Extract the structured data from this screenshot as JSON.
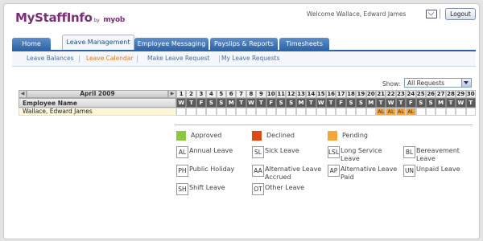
{
  "app": {
    "logo_main": "MyStaffInfo",
    "logo_by": "by",
    "logo_brand": "myob",
    "welcome": "Welcome Wallace, Edward James",
    "logout": "Logout"
  },
  "tabs": [
    {
      "label": "Home",
      "active": false
    },
    {
      "label": "Leave Management",
      "active": true
    },
    {
      "label": "Employee Messaging",
      "active": false
    },
    {
      "label": "Payslips & Reports",
      "active": false
    },
    {
      "label": "Timesheets",
      "active": false
    }
  ],
  "subnav": [
    {
      "label": "Leave Balances",
      "active": false
    },
    {
      "label": "Leave Calendar",
      "active": true
    },
    {
      "label": "Make Leave Request",
      "active": false
    },
    {
      "label": "My Leave Requests",
      "active": false
    }
  ],
  "filter": {
    "show_label": "Show:",
    "selected": "All Requests"
  },
  "calendar": {
    "month": "April 2009",
    "prev": "◀",
    "next": "▶",
    "employee_header": "Employee Name",
    "days": [
      "1",
      "2",
      "3",
      "4",
      "5",
      "6",
      "7",
      "8",
      "9",
      "10",
      "11",
      "12",
      "13",
      "14",
      "15",
      "16",
      "17",
      "18",
      "19",
      "20",
      "21",
      "22",
      "23",
      "24",
      "25",
      "26",
      "27",
      "28",
      "29",
      "30"
    ],
    "weekdays": [
      "W",
      "T",
      "F",
      "S",
      "S",
      "M",
      "T",
      "W",
      "T",
      "F",
      "S",
      "S",
      "M",
      "T",
      "W",
      "T",
      "F",
      "S",
      "S",
      "M",
      "T",
      "W",
      "T",
      "F",
      "S",
      "S",
      "M",
      "T",
      "W",
      "T"
    ],
    "employees": [
      {
        "name": "Wallace, Edward James",
        "cells": [
          "",
          "",
          "",
          "",
          "",
          "",
          "",
          "",
          "",
          "",
          "",
          "",
          "",
          "",
          "",
          "",
          "",
          "",
          "",
          "",
          "AL",
          "AL",
          "AL",
          "AL",
          "",
          "",
          "",
          "",
          "",
          ""
        ]
      }
    ]
  },
  "legend": {
    "statuses": [
      {
        "label": "Approved",
        "color": "#8dc63f"
      },
      {
        "label": "Declined",
        "color": "#e04a12"
      },
      {
        "label": "Pending",
        "color": "#f6a53a"
      }
    ],
    "codes": [
      {
        "code": "AL",
        "label": "Annual Leave"
      },
      {
        "code": "SL",
        "label": "Sick Leave"
      },
      {
        "code": "LSL",
        "label": "Long Service Leave"
      },
      {
        "code": "BL",
        "label": "Bereavement Leave"
      },
      {
        "code": "PH",
        "label": "Public Holiday"
      },
      {
        "code": "AA",
        "label": "Alternative Leave Accrued"
      },
      {
        "code": "AP",
        "label": "Alternative Leave Paid"
      },
      {
        "code": "UN",
        "label": "Unpaid Leave"
      },
      {
        "code": "SH",
        "label": "Shift Leave"
      },
      {
        "code": "OT",
        "label": "Other Leave"
      }
    ]
  },
  "colors": {
    "pending": "#f6a53a",
    "weekday_header": "#5a5a5a",
    "row_highlight": "#fff8d6",
    "tab_blue": "#2d62a6"
  }
}
